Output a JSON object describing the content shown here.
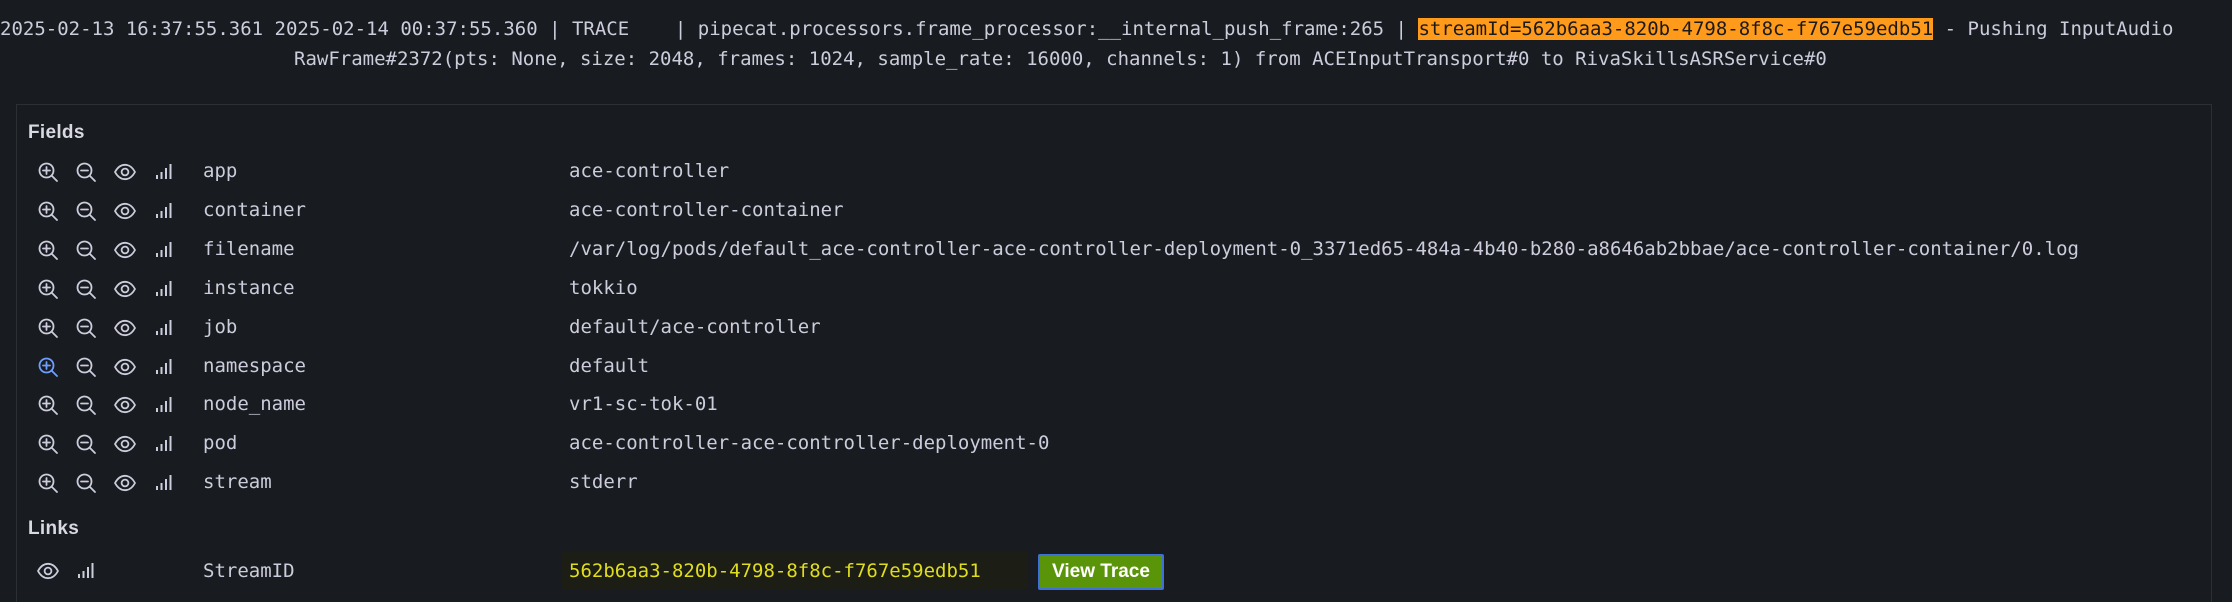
{
  "log": {
    "line1_prefix": "2025-02-13 16:37:55.361 2025-02-14 00:37:55.360 | TRACE    | pipecat.processors.frame_processor:__internal_push_frame:265 | ",
    "line1_highlight": "streamId=562b6aa3-820b-4798-8f8c-f767e59edb51",
    "line1_suffix": " - Pushing InputAudio",
    "line2": "RawFrame#2372(pts: None, size: 2048, frames: 1024, sample_rate: 16000, channels: 1) from ACEInputTransport#0 to RivaSkillsASRService#0",
    "highlight_color": "#ff9a1a"
  },
  "fields_title": "Fields",
  "fields": [
    {
      "label": "app",
      "value": "ace-controller"
    },
    {
      "label": "container",
      "value": "ace-controller-container"
    },
    {
      "label": "filename",
      "value": "/var/log/pods/default_ace-controller-ace-controller-deployment-0_3371ed65-484a-4b40-b280-a8646ab2bbae/ace-controller-container/0.log"
    },
    {
      "label": "instance",
      "value": "tokkio"
    },
    {
      "label": "job",
      "value": "default/ace-controller"
    },
    {
      "label": "namespace",
      "value": "default"
    },
    {
      "label": "node_name",
      "value": "vr1-sc-tok-01"
    },
    {
      "label": "pod",
      "value": "ace-controller-ace-controller-deployment-0"
    },
    {
      "label": "stream",
      "value": "stderr"
    }
  ],
  "field_icons": [
    "zoom-in-icon",
    "zoom-out-icon",
    "eye-icon",
    "stats-icon"
  ],
  "links_title": "Links",
  "links": [
    {
      "label": "StreamID",
      "value": "562b6aa3-820b-4798-8f8c-f767e59edb51",
      "button": "View Trace"
    }
  ],
  "link_icons": [
    "eye-icon",
    "stats-icon"
  ],
  "colors": {
    "background": "#181b1f",
    "text": "#ccccdc",
    "link_value": "#e0dd1e",
    "button_bg": "#5a9408",
    "button_border": "#3d71d9",
    "active_icon": "#6e9fff"
  },
  "hovered_field_index": 5
}
